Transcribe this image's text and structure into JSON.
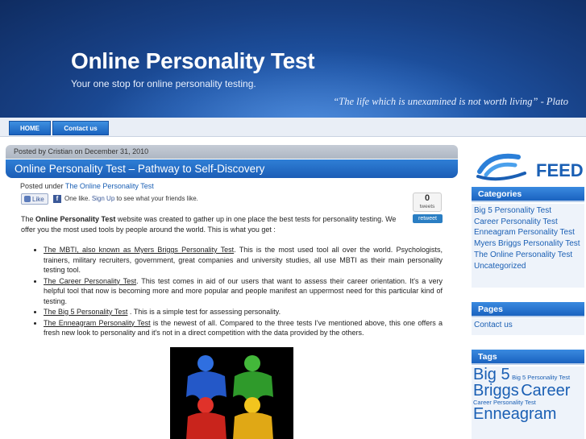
{
  "header": {
    "title": "Online Personality Test",
    "description": "Your one stop for online personality testing.",
    "quote": "“The life which is unexamined is not worth living” - Plato"
  },
  "nav": {
    "home": "HOME",
    "contact": "Contact us"
  },
  "post": {
    "meta": "Posted by Cristian on December 31, 2010",
    "title": "Online Personality Test – Pathway to Self-Discovery",
    "posted_under_label": "Posted under",
    "category": "The Online Personality Test",
    "intro_before": "The ",
    "intro_bold": "Online Personality Test",
    "intro_after": " website was created to gather up in one place the best tests for personality testing. We offer you the most used tools by people around the world. This is what you get :",
    "list": [
      {
        "link": "The MBTI, also known as Myers Briggs Personality Test",
        "text": ". This is the most used tool all over the world. Psychologists, trainers, military recruiters, government, great companies and university studies, all use MBTI as their main personality testing tool."
      },
      {
        "link": "The Career Personality Test",
        "text": ". This test comes in aid of our users that want to assess their career orientation. It's a very helpful tool that now is becoming more and more popular and people manifest an uppermost need for this particular kind of testing."
      },
      {
        "link": "The Big 5 Personality Test",
        "text": " . This is a simple test for assessing personality."
      },
      {
        "link": "The Enneagram Personality Test",
        "text": " is the newest of all. Compared to the three tests I've mentioned above, this one offers a fresh new look to personality and it's not in a direct competition with the data provided by the others."
      }
    ]
  },
  "facebook": {
    "like_button": "Like",
    "one_like": "One like.",
    "sign_up": "Sign Up",
    "see_friends": "to see what your friends like."
  },
  "tweet": {
    "count": "0",
    "label": "tweets",
    "retweet": "retweet"
  },
  "sidebar": {
    "feed": "FEED",
    "categories_title": "Categories",
    "categories": [
      "Big 5 Personality Test",
      "Career Personality Test",
      "Enneagram Personality Test",
      "Myers Briggs Personality Test",
      "The Online Personality Test",
      "Uncategorized"
    ],
    "pages_title": "Pages",
    "pages": [
      "Contact us"
    ],
    "tags_title": "Tags",
    "tags": [
      {
        "text": "Big 5",
        "size": "lg"
      },
      {
        "text": "Big 5 Personality Test",
        "size": "sm"
      },
      {
        "text": "Briggs",
        "size": "lg"
      },
      {
        "text": "Career",
        "size": "lg"
      },
      {
        "text": "Career Personality Test",
        "size": "sm"
      },
      {
        "text": "Enneagram",
        "size": "lg"
      }
    ]
  },
  "colors": {
    "header_bg": "#1f56a8",
    "nav_blue": "#1a63bf",
    "link": "#1a5fb4"
  }
}
